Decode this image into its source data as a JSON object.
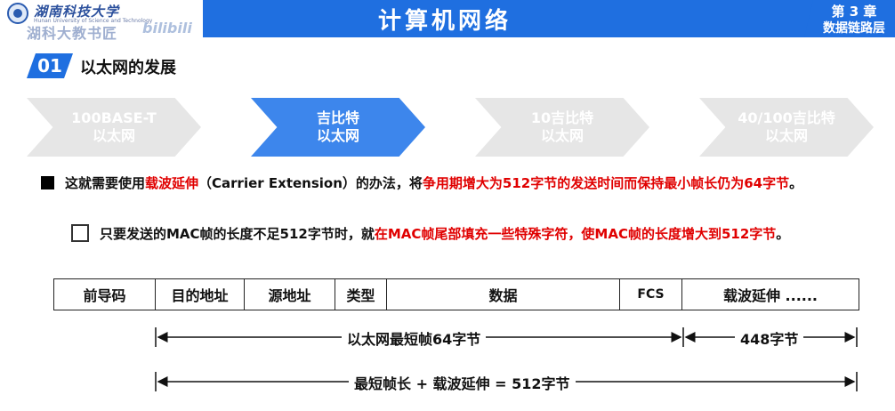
{
  "header": {
    "school_name": "湖南科技大学",
    "school_name_en": "Hunan University of Science and Technology",
    "watermark": "湖科大教书匠",
    "watermark_logo": "bilibili",
    "title": "计算机网络",
    "chapter": "第 3 章",
    "chapter_sub": "数据链路层",
    "accent_color": "#1f6fe0"
  },
  "section": {
    "number": "01",
    "title": "以太网的发展"
  },
  "chevrons": [
    {
      "line1": "100BASE-T",
      "line2": "以太网",
      "active": false
    },
    {
      "line1": "吉比特",
      "line2": "以太网",
      "active": true
    },
    {
      "line1": "10吉比特",
      "line2": "以太网",
      "active": false
    },
    {
      "line1": "40/100吉比特",
      "line2": "以太网",
      "active": false
    }
  ],
  "bullet1": {
    "t1": "这就需要使用",
    "r1": "载波延伸",
    "t2": "（Carrier Extension）的办法，将",
    "r2": "争用期增大为512字节的发送时间而保持最小帧长仍为64字节",
    "t3": "。"
  },
  "bullet2": {
    "t1": "只要发送的MAC帧的长度不足512字节时，就",
    "r1": "在MAC帧尾部填充一些特殊字符，使MAC帧的长度增大到512字节",
    "t2": "。"
  },
  "frame": {
    "fields": [
      "前导码",
      "目的地址",
      "源地址",
      "类型",
      "数据",
      "FCS",
      "载波延伸 ......"
    ]
  },
  "annotations": {
    "min_frame": "以太网最短帧64字节",
    "extension": "448字节",
    "total": "最短帧长 + 载波延伸 = 512字节"
  }
}
